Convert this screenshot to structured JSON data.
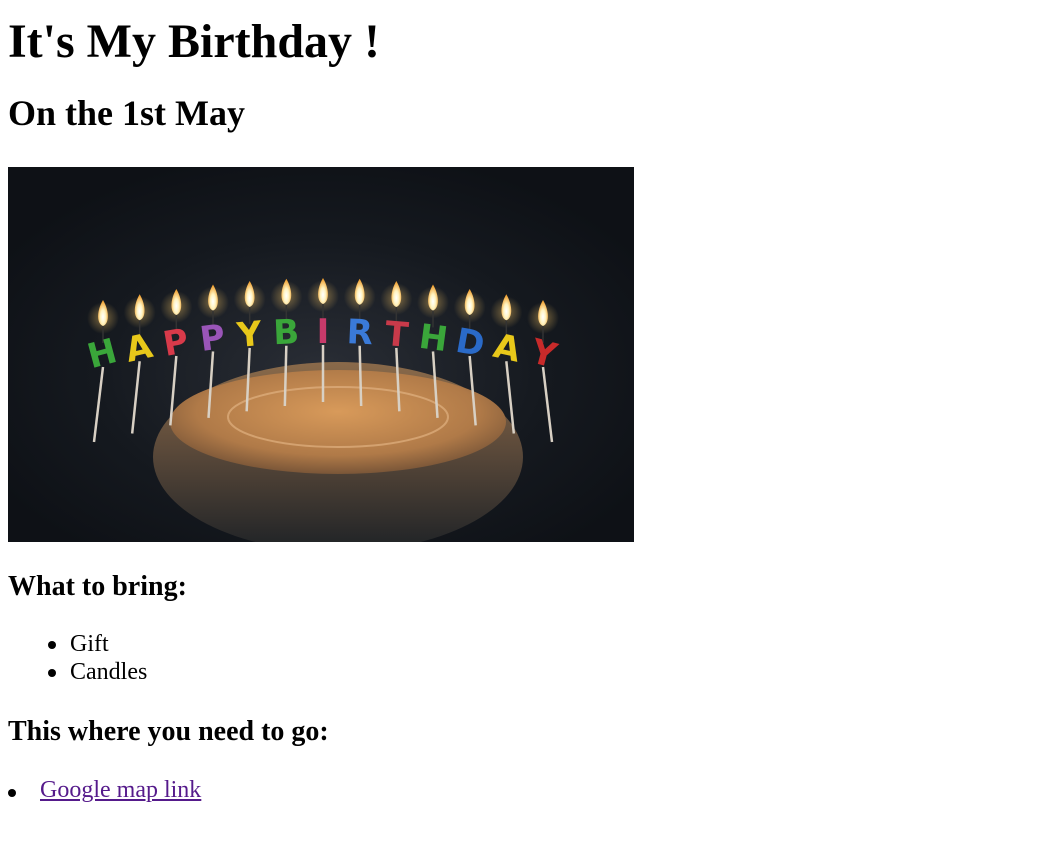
{
  "page": {
    "title": "It's My Birthday !",
    "subtitle": "On the 1st May"
  },
  "hero_image": {
    "alt": "Birthday cake with HAPPY BIRTHDAY candles",
    "candle_letters": [
      "H",
      "A",
      "P",
      "P",
      "Y",
      "B",
      "I",
      "R",
      "T",
      "H",
      "D",
      "A",
      "Y"
    ],
    "candle_colors": [
      "#3aa63a",
      "#e8c81a",
      "#d83a4a",
      "#9a55b8",
      "#e8c81a",
      "#3aa63a",
      "#c83a6a",
      "#3a7ad8",
      "#c83a4a",
      "#3aa63a",
      "#2a6ac8",
      "#e8c81a",
      "#c82a2a"
    ]
  },
  "bring": {
    "heading": "What to bring:",
    "items": [
      "Gift",
      "Candles"
    ]
  },
  "directions": {
    "heading": "This where you need to go:",
    "link_label": "Google map link"
  }
}
